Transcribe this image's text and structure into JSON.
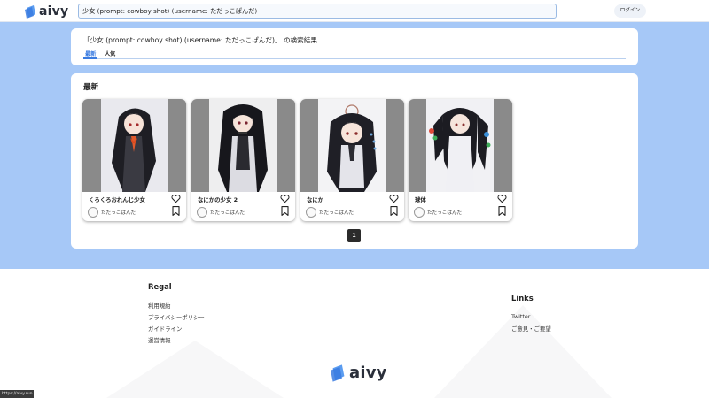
{
  "brand": {
    "name": "aivy",
    "accent": "#3a7be0",
    "band_color": "#a6c8f7"
  },
  "header": {
    "search_value": "少女 (prompt: cowboy shot) (username: ただっこぱんだ)",
    "login_label": "ログイン"
  },
  "search_result": {
    "title": "「少女 (prompt: cowboy shot) (username: ただっこぱんだ)」 の検索結果",
    "tabs": [
      {
        "label": "最新",
        "active": true
      },
      {
        "label": "人気",
        "active": false
      }
    ]
  },
  "latest": {
    "heading": "最新",
    "cards": [
      {
        "title": "くろくろおれんじ少女",
        "author": "ただっこぱんだ",
        "image": "anime girl with black hair, red bow"
      },
      {
        "title": "なにかの少女 2",
        "author": "ただっこぱんだ",
        "image": "anime girl with long black hair, dark outfit"
      },
      {
        "title": "なにか",
        "author": "ただっこぱんだ",
        "image": "anime girl with black hair, white outfit"
      },
      {
        "title": "球体",
        "author": "ただっこぱんだ",
        "image": "anime girl with twin tails, white dress"
      }
    ],
    "pagination": {
      "current_page": "1"
    }
  },
  "footer": {
    "regal": {
      "heading": "Regal",
      "links": [
        "利用規約",
        "プライバシーポリシー",
        "ガイドライン",
        "運営情報"
      ]
    },
    "links": {
      "heading": "Links",
      "items": [
        "Twitter",
        "ご意見・ご要望"
      ]
    },
    "logo_text": "aivy"
  },
  "status_bar": {
    "url": "https://aivy.run"
  },
  "icons": {
    "heart": "heart-outline-icon",
    "bookmark": "bookmark-outline-icon",
    "avatar": "panda-avatar-icon"
  }
}
